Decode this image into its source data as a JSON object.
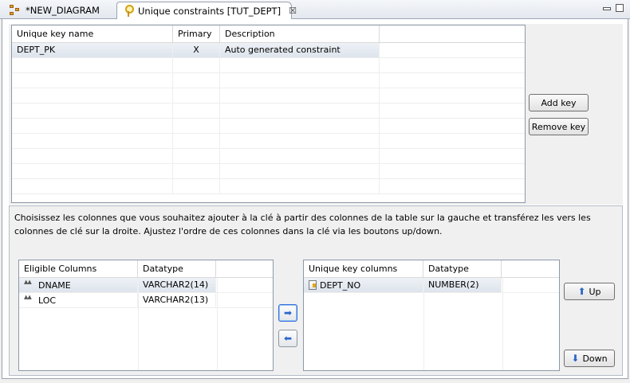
{
  "tabs": [
    {
      "label": "*NEW_DIAGRAM",
      "icon": "diagram-icon",
      "active": false
    },
    {
      "label": "Unique constraints [TUT_DEPT]",
      "icon": "key-icon",
      "active": true,
      "close": "☒"
    }
  ],
  "unique_keys": {
    "columns": [
      "Unique key name",
      "Primary",
      "Description",
      ""
    ],
    "rows": [
      {
        "name": "DEPT_PK",
        "primary": "X",
        "description": "Auto generated constraint"
      }
    ]
  },
  "buttons": {
    "add_key": "Add key",
    "remove_key": "Remove key",
    "up": "Up",
    "down": "Down"
  },
  "instructions": "Choisissez les colonnes que vous souhaitez ajouter à la clé à partir des colonnes de la table sur la gauche et transférez les vers les colonnes de clé sur la droite. Ajustez l'ordre de ces colonnes dans la clé via les boutons up/down.",
  "eligible": {
    "columns": [
      "Eligible Columns",
      "Datatype",
      ""
    ],
    "rows": [
      {
        "name": "DNAME",
        "datatype": "VARCHAR2(14)"
      },
      {
        "name": "LOC",
        "datatype": "VARCHAR2(13)"
      }
    ]
  },
  "key_columns": {
    "columns": [
      "Unique key columns",
      "Datatype",
      ""
    ],
    "rows": [
      {
        "name": "DEPT_NO",
        "datatype": "NUMBER(2)"
      }
    ]
  },
  "transfer": {
    "right_glyph": "➡",
    "left_glyph": "⬅"
  },
  "move_glyphs": {
    "up": "⬆",
    "down": "⬇"
  },
  "colors": {
    "selection": "#dde4ec",
    "focus_border": "#2f6fd8",
    "arrow_blue": "#2a66c9"
  }
}
